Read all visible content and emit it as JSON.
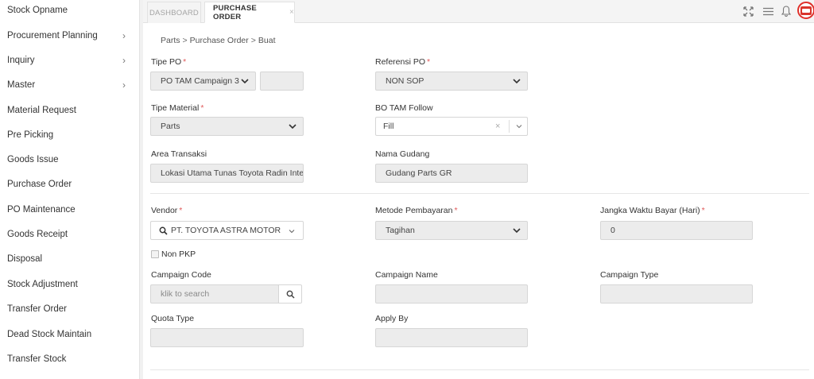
{
  "sidebar": {
    "items": [
      {
        "label": "Stock Opname",
        "chevron": false
      },
      {
        "label": "Procurement Planning",
        "chevron": true
      },
      {
        "label": "Inquiry",
        "chevron": true
      },
      {
        "label": "Master",
        "chevron": true
      },
      {
        "label": "Material Request",
        "chevron": false
      },
      {
        "label": "Pre Picking",
        "chevron": false
      },
      {
        "label": "Goods Issue",
        "chevron": false
      },
      {
        "label": "Purchase Order",
        "chevron": false
      },
      {
        "label": "PO Maintenance",
        "chevron": false
      },
      {
        "label": "Goods Receipt",
        "chevron": false
      },
      {
        "label": "Disposal",
        "chevron": false
      },
      {
        "label": "Stock Adjustment",
        "chevron": false
      },
      {
        "label": "Transfer Order",
        "chevron": false
      },
      {
        "label": "Dead Stock Maintain",
        "chevron": false
      },
      {
        "label": "Transfer Stock",
        "chevron": false
      }
    ]
  },
  "tabs": {
    "dashboard": "DASHBOARD",
    "purchase_order": "PURCHASE ORDER",
    "close": "×"
  },
  "breadcrumb": {
    "level1": "Parts",
    "level2": "Purchase Order",
    "level3": "Buat",
    "sep": ">"
  },
  "form": {
    "tipe_po": {
      "label": "Tipe PO",
      "value": "PO TAM Campaign 3",
      "extra": ""
    },
    "referensi_po": {
      "label": "Referensi PO",
      "value": "NON SOP"
    },
    "tipe_material": {
      "label": "Tipe Material",
      "value": "Parts"
    },
    "bo_tam_follow": {
      "label": "BO TAM Follow",
      "value": "Fill",
      "clear": "×"
    },
    "area_transaksi": {
      "label": "Area Transaksi",
      "value": "Lokasi Utama Tunas Toyota Radin Inten"
    },
    "nama_gudang": {
      "label": "Nama Gudang",
      "value": "Gudang Parts GR"
    },
    "vendor": {
      "label": "Vendor",
      "value": "PT. TOYOTA ASTRA MOTOR"
    },
    "metode_pembayaran": {
      "label": "Metode Pembayaran",
      "value": "Tagihan"
    },
    "jangka_waktu": {
      "label": "Jangka Waktu Bayar (Hari)",
      "value": "0"
    },
    "non_pkp": {
      "label": "Non PKP",
      "checked": false
    },
    "campaign_code": {
      "label": "Campaign Code",
      "placeholder": "klik to search"
    },
    "campaign_name": {
      "label": "Campaign Name",
      "value": ""
    },
    "campaign_type": {
      "label": "Campaign Type",
      "value": ""
    },
    "quota_type": {
      "label": "Quota Type",
      "value": ""
    },
    "apply_by": {
      "label": "Apply By",
      "value": ""
    },
    "required_mark": "*"
  },
  "icons": {
    "fullscreen": "expand-icon",
    "menu": "hamburger-menu-icon",
    "notification": "bell-icon",
    "avatar": "user-avatar"
  },
  "colors": {
    "required": "#e05a5a",
    "avatar_ring": "#e0302a",
    "field_bg": "#ececec"
  }
}
